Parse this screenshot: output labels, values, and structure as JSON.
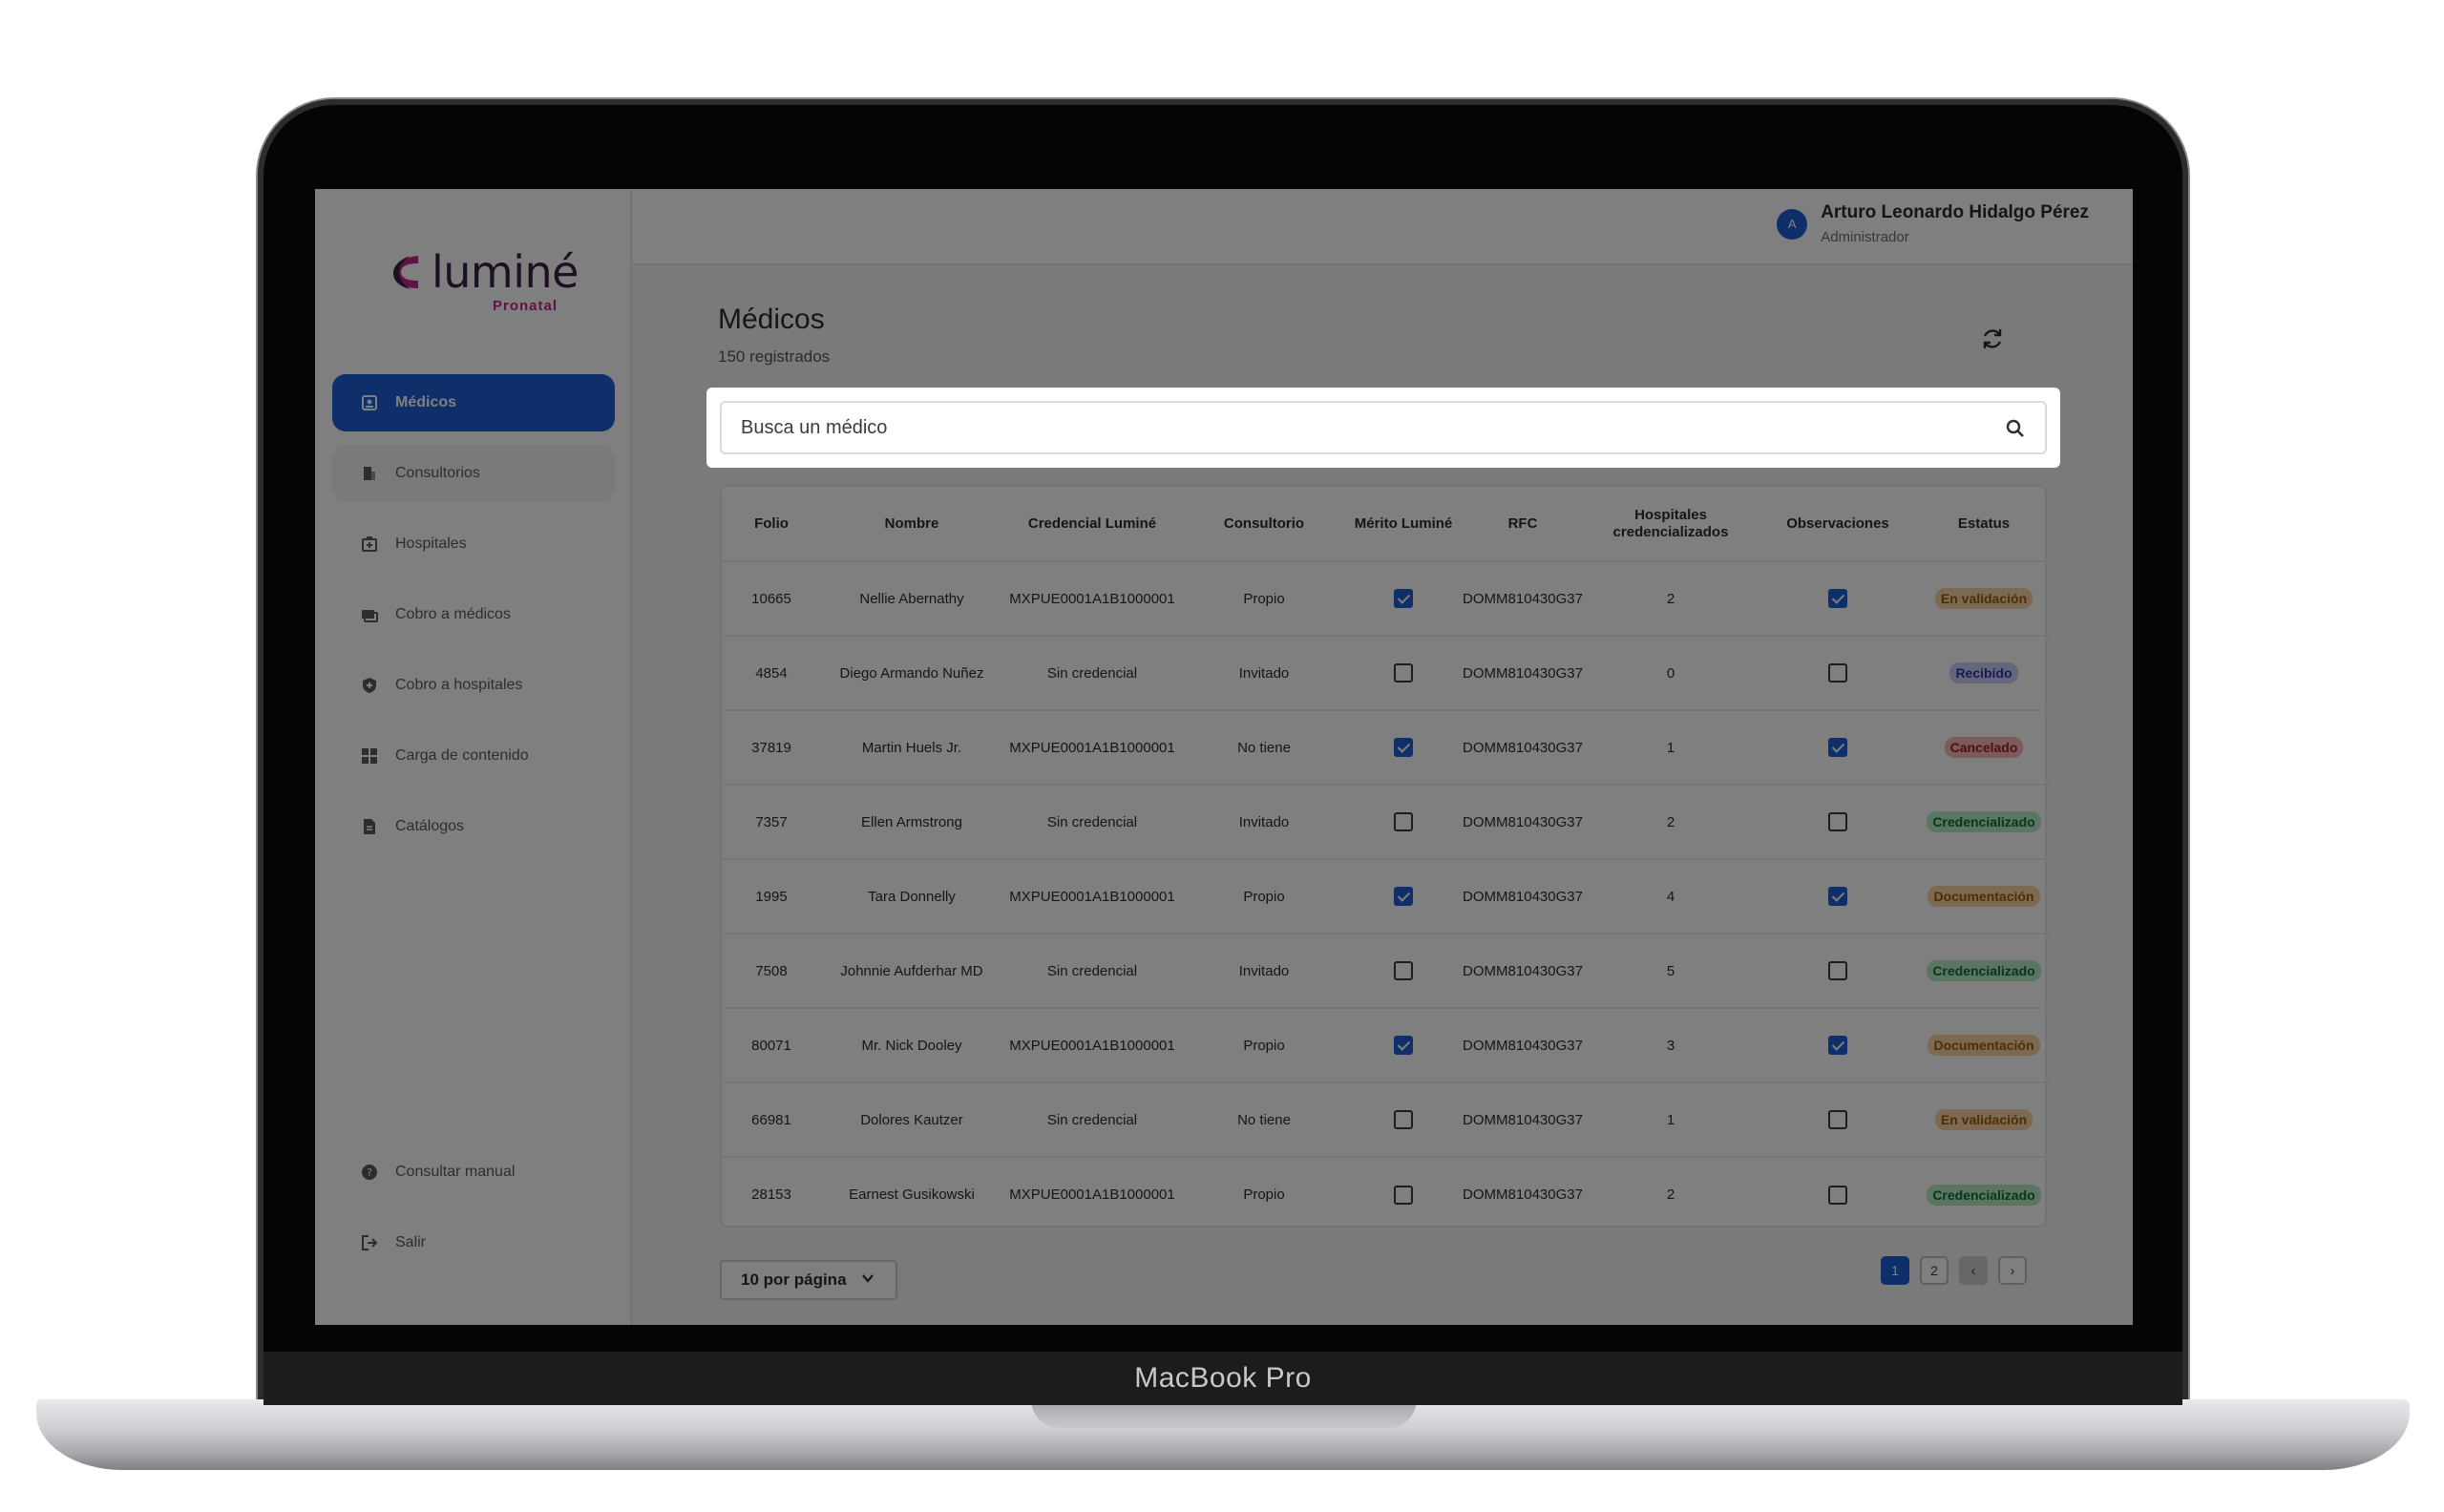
{
  "device": {
    "label": "MacBook Pro"
  },
  "brand": {
    "name": "luminé",
    "sub": "Pronatal",
    "primary": "#1f5fd6",
    "accent": "#c5218a"
  },
  "sidebar": {
    "items": [
      {
        "label": "Médicos",
        "icon": "badge-icon",
        "active": true
      },
      {
        "label": "Consultorios",
        "icon": "building-icon"
      },
      {
        "label": "Hospitales",
        "icon": "hospital-icon"
      },
      {
        "label": "Cobro a médicos",
        "icon": "payment-icon"
      },
      {
        "label": "Cobro a hospitales",
        "icon": "shield-icon"
      },
      {
        "label": "Carga de contenido",
        "icon": "dashboard-icon"
      },
      {
        "label": "Catálogos",
        "icon": "document-icon"
      }
    ],
    "bottom": [
      {
        "label": "Consultar manual",
        "icon": "help-icon"
      },
      {
        "label": "Salir",
        "icon": "logout-icon"
      }
    ]
  },
  "user": {
    "initial": "A",
    "name": "Arturo Leonardo Hidalgo Pérez",
    "role": "Administrador"
  },
  "page": {
    "title": "Médicos",
    "subtitle": "150 registrados"
  },
  "search": {
    "placeholder": "Busca un médico"
  },
  "table": {
    "headers": [
      "Folio",
      "Nombre",
      "Credencial Luminé",
      "Consultorio",
      "Mérito Luminé",
      "RFC",
      "Hospitales credencializados",
      "Observaciones",
      "Estatus"
    ],
    "rows": [
      {
        "folio": "10665",
        "nombre": "Nellie Abernathy",
        "credencial": "MXPUE0001A1B1000001",
        "consultorio": "Propio",
        "merito": true,
        "rfc": "DOMM810430G37",
        "hospitales": "2",
        "observaciones": true,
        "estatus": "En validación"
      },
      {
        "folio": "4854",
        "nombre": "Diego Armando Nuñez",
        "credencial": "Sin credencial",
        "consultorio": "Invitado",
        "merito": false,
        "rfc": "DOMM810430G37",
        "hospitales": "0",
        "observaciones": false,
        "estatus": "Recibido"
      },
      {
        "folio": "37819",
        "nombre": "Martin Huels Jr.",
        "credencial": "MXPUE0001A1B1000001",
        "consultorio": "No tiene",
        "merito": true,
        "rfc": "DOMM810430G37",
        "hospitales": "1",
        "observaciones": true,
        "estatus": "Cancelado"
      },
      {
        "folio": "7357",
        "nombre": "Ellen Armstrong",
        "credencial": "Sin credencial",
        "consultorio": "Invitado",
        "merito": false,
        "rfc": "DOMM810430G37",
        "hospitales": "2",
        "observaciones": false,
        "estatus": "Credencializado"
      },
      {
        "folio": "1995",
        "nombre": "Tara Donnelly",
        "credencial": "MXPUE0001A1B1000001",
        "consultorio": "Propio",
        "merito": true,
        "rfc": "DOMM810430G37",
        "hospitales": "4",
        "observaciones": true,
        "estatus": "Documentación"
      },
      {
        "folio": "7508",
        "nombre": "Johnnie Aufderhar MD",
        "credencial": "Sin credencial",
        "consultorio": "Invitado",
        "merito": false,
        "rfc": "DOMM810430G37",
        "hospitales": "5",
        "observaciones": false,
        "estatus": "Credencializado"
      },
      {
        "folio": "80071",
        "nombre": "Mr. Nick Dooley",
        "credencial": "MXPUE0001A1B1000001",
        "consultorio": "Propio",
        "merito": true,
        "rfc": "DOMM810430G37",
        "hospitales": "3",
        "observaciones": true,
        "estatus": "Documentación"
      },
      {
        "folio": "66981",
        "nombre": "Dolores Kautzer",
        "credencial": "Sin credencial",
        "consultorio": "No tiene",
        "merito": false,
        "rfc": "DOMM810430G37",
        "hospitales": "1",
        "observaciones": false,
        "estatus": "En validación"
      },
      {
        "folio": "28153",
        "nombre": "Earnest Gusikowski",
        "credencial": "MXPUE0001A1B1000001",
        "consultorio": "Propio",
        "merito": false,
        "rfc": "DOMM810430G37",
        "hospitales": "2",
        "observaciones": false,
        "estatus": "Credencializado"
      }
    ]
  },
  "status_colors": {
    "En validación": {
      "bg": "#f6d3a2",
      "fg": "#9a5a0e"
    },
    "Recibido": {
      "bg": "#c9ccf7",
      "fg": "#2e35a8"
    },
    "Cancelado": {
      "bg": "#f6b8b8",
      "fg": "#a11d1d"
    },
    "Credencializado": {
      "bg": "#b4ecc6",
      "fg": "#136a31"
    },
    "Documentación": {
      "bg": "#f6d3a2",
      "fg": "#9a5a0e"
    }
  },
  "pagination": {
    "per_page_label": "10 por página",
    "pages": [
      "1",
      "2"
    ],
    "current": "1",
    "prev": "‹",
    "next": "›"
  }
}
